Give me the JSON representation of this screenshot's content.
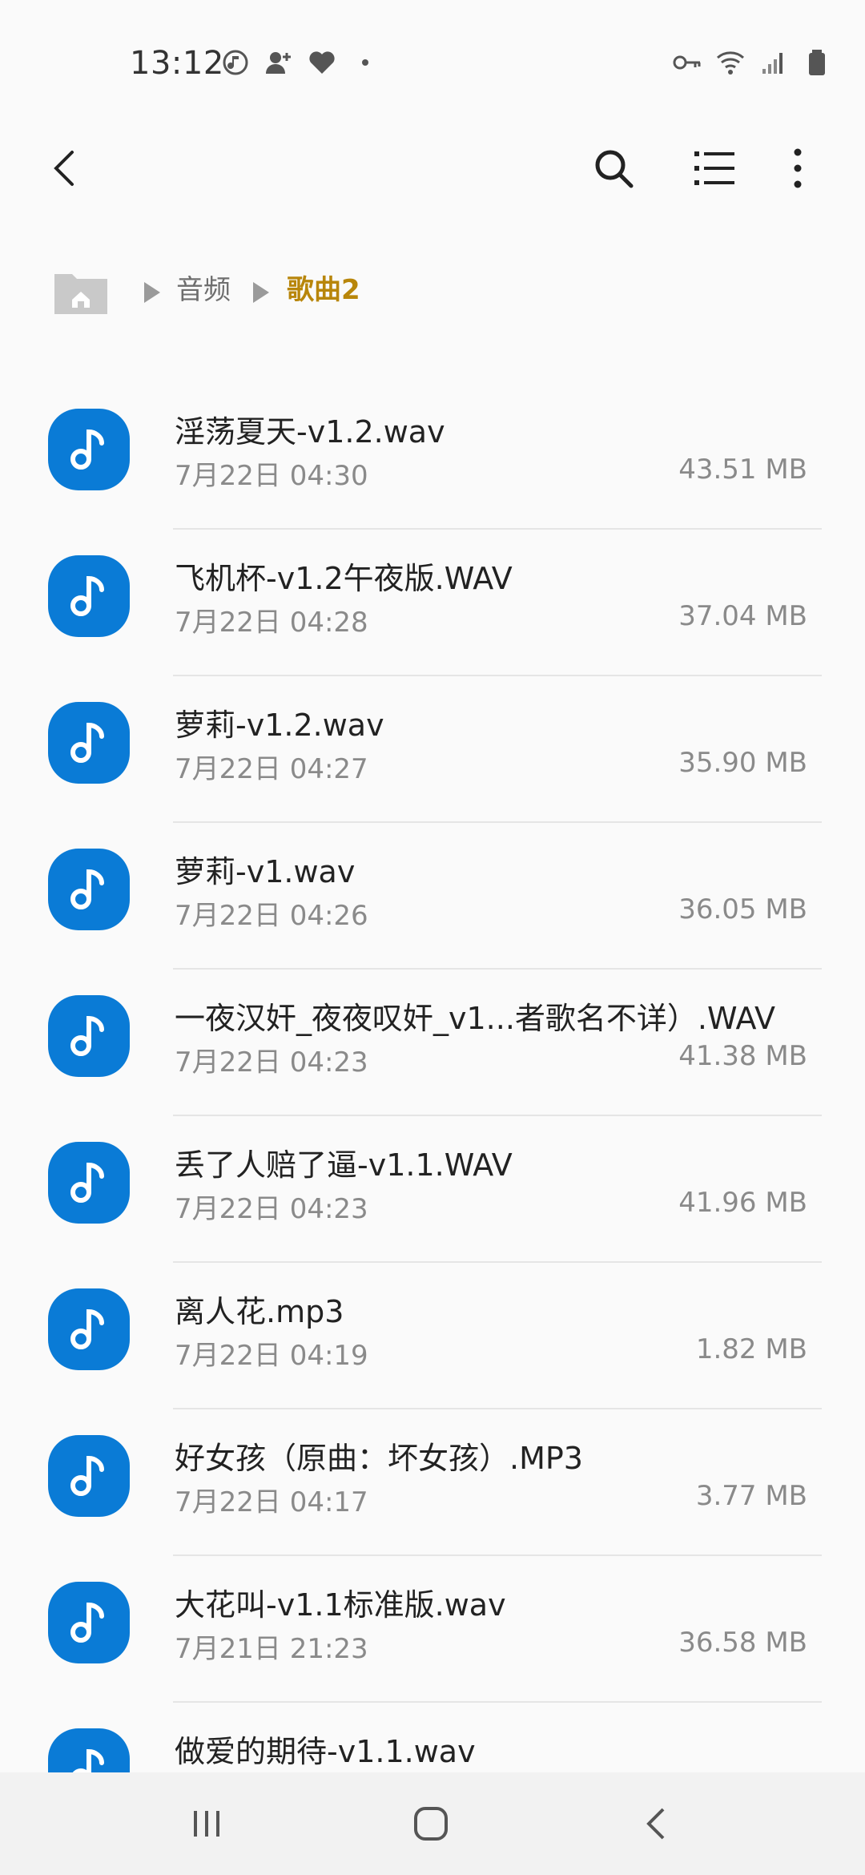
{
  "status_bar": {
    "time": "13:12",
    "left_icons": [
      "music-sync-icon",
      "person-add-icon",
      "heart-icon",
      "dot-icon"
    ],
    "right_icons": [
      "key-icon",
      "wifi-icon",
      "signal-icon",
      "battery-icon"
    ]
  },
  "app_bar": {
    "back_icon": "back-arrow-icon",
    "actions": [
      "search-icon",
      "list-view-icon",
      "more-vert-icon"
    ]
  },
  "breadcrumb": {
    "home_icon": "home-folder-icon",
    "parent": "音频",
    "current": "歌曲2",
    "colors": {
      "parent": "#6e6e6e",
      "current": "#b8860b"
    }
  },
  "files": [
    {
      "name": "淫荡夏天-v1.2.wav",
      "date": "7月22日 04:30",
      "size": "43.51 MB"
    },
    {
      "name": "飞机杯-v1.2午夜版.WAV",
      "date": "7月22日 04:28",
      "size": "37.04 MB"
    },
    {
      "name": "萝莉-v1.2.wav",
      "date": "7月22日 04:27",
      "size": "35.90 MB"
    },
    {
      "name": "萝莉-v1.wav",
      "date": "7月22日 04:26",
      "size": "36.05 MB"
    },
    {
      "name": "一夜汉奸_夜夜叹奸_v1...者歌名不详）.WAV",
      "date": "7月22日 04:23",
      "size": "41.38 MB"
    },
    {
      "name": "丢了人赔了逼-v1.1.WAV",
      "date": "7月22日 04:23",
      "size": "41.96 MB"
    },
    {
      "name": "离人花.mp3",
      "date": "7月22日 04:19",
      "size": "1.82 MB"
    },
    {
      "name": "好女孩（原曲：坏女孩）.MP3",
      "date": "7月22日 04:17",
      "size": "3.77 MB"
    },
    {
      "name": "大花叫-v1.1标准版.wav",
      "date": "7月21日 21:23",
      "size": "36.58 MB"
    },
    {
      "name": "做爱的期待-v1.1.wav",
      "date": "",
      "size": ""
    }
  ],
  "file_icon": {
    "name": "music-note-icon",
    "color": "#0a7bd6"
  },
  "nav_bar": [
    "recent-apps-icon",
    "home-icon",
    "nav-back-icon"
  ]
}
